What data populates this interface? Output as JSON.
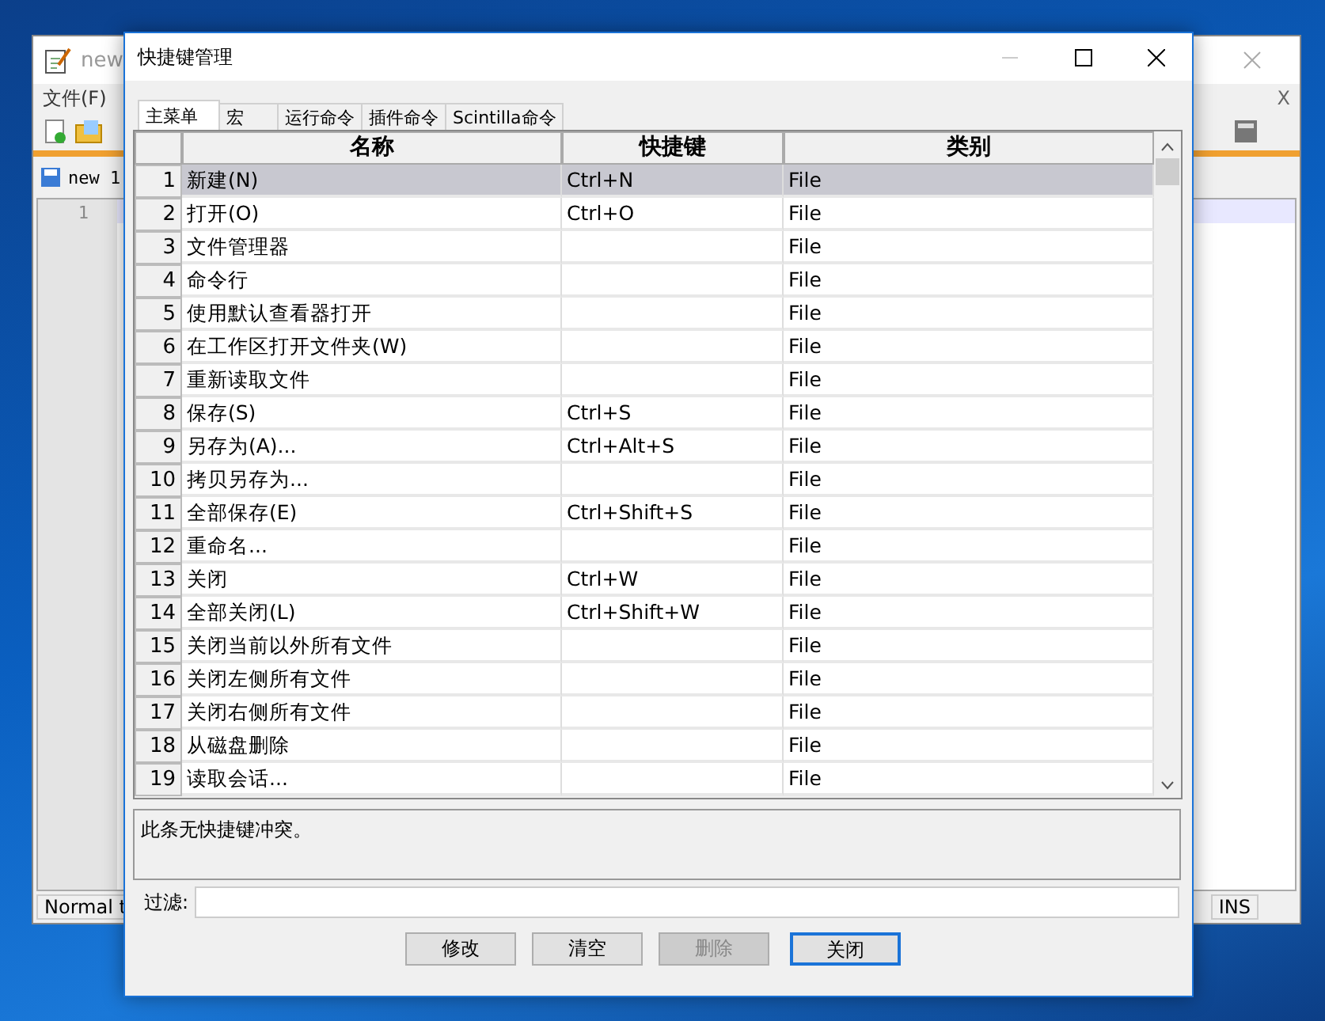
{
  "background_window": {
    "title": "new",
    "menu": [
      "文件(F)"
    ],
    "menu_close": "X",
    "tab": "new 1",
    "line_number": "1",
    "status_left": "Normal t",
    "status_right": "INS"
  },
  "dialog": {
    "title": "快捷键管理",
    "tabs": [
      {
        "label": "主菜单",
        "selected": true
      },
      {
        "label": "宏",
        "selected": false
      },
      {
        "label": "运行命令",
        "selected": false
      },
      {
        "label": "插件命令",
        "selected": false
      },
      {
        "label": "Scintilla命令",
        "selected": false
      }
    ],
    "table": {
      "columns": [
        "名称",
        "快捷键",
        "类别"
      ],
      "rows": [
        {
          "number": "1",
          "name": "新建(N)",
          "shortcut": "Ctrl+N",
          "category": "File",
          "selected": true
        },
        {
          "number": "2",
          "name": "打开(O)",
          "shortcut": "Ctrl+O",
          "category": "File",
          "selected": false
        },
        {
          "number": "3",
          "name": "文件管理器",
          "shortcut": "",
          "category": "File",
          "selected": false
        },
        {
          "number": "4",
          "name": "命令行",
          "shortcut": "",
          "category": "File",
          "selected": false
        },
        {
          "number": "5",
          "name": "使用默认查看器打开",
          "shortcut": "",
          "category": "File",
          "selected": false
        },
        {
          "number": "6",
          "name": "在工作区打开文件夹(W)",
          "shortcut": "",
          "category": "File",
          "selected": false
        },
        {
          "number": "7",
          "name": "重新读取文件",
          "shortcut": "",
          "category": "File",
          "selected": false
        },
        {
          "number": "8",
          "name": "保存(S)",
          "shortcut": "Ctrl+S",
          "category": "File",
          "selected": false
        },
        {
          "number": "9",
          "name": "另存为(A)...",
          "shortcut": "Ctrl+Alt+S",
          "category": "File",
          "selected": false
        },
        {
          "number": "10",
          "name": "拷贝另存为...",
          "shortcut": "",
          "category": "File",
          "selected": false
        },
        {
          "number": "11",
          "name": "全部保存(E)",
          "shortcut": "Ctrl+Shift+S",
          "category": "File",
          "selected": false
        },
        {
          "number": "12",
          "name": "重命名...",
          "shortcut": "",
          "category": "File",
          "selected": false
        },
        {
          "number": "13",
          "name": "关闭",
          "shortcut": "Ctrl+W",
          "category": "File",
          "selected": false
        },
        {
          "number": "14",
          "name": "全部关闭(L)",
          "shortcut": "Ctrl+Shift+W",
          "category": "File",
          "selected": false
        },
        {
          "number": "15",
          "name": "关闭当前以外所有文件",
          "shortcut": "",
          "category": "File",
          "selected": false
        },
        {
          "number": "16",
          "name": "关闭左侧所有文件",
          "shortcut": "",
          "category": "File",
          "selected": false
        },
        {
          "number": "17",
          "name": "关闭右侧所有文件",
          "shortcut": "",
          "category": "File",
          "selected": false
        },
        {
          "number": "18",
          "name": "从磁盘删除",
          "shortcut": "",
          "category": "File",
          "selected": false
        },
        {
          "number": "19",
          "name": "读取会话...",
          "shortcut": "",
          "category": "File",
          "selected": false
        }
      ]
    },
    "message": "此条无快捷键冲突。",
    "filter": {
      "label": "过滤:"
    },
    "buttons": [
      {
        "label": "修改",
        "disabled": false,
        "default": false
      },
      {
        "label": "清空",
        "disabled": false,
        "default": false
      },
      {
        "label": "删除",
        "disabled": true,
        "default": false
      },
      {
        "label": "关闭",
        "disabled": false,
        "default": true
      }
    ]
  }
}
